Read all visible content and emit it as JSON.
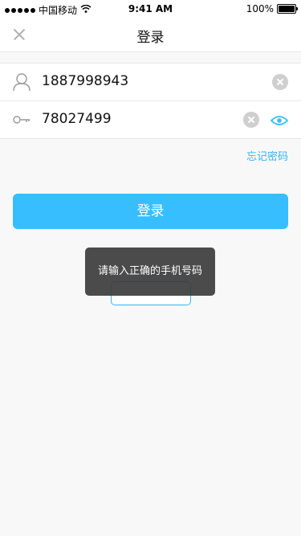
{
  "status_bar": {
    "carrier": "中国移动",
    "time": "9:41 AM",
    "battery": "100%"
  },
  "nav": {
    "title": "登录",
    "close_icon": "close-icon"
  },
  "form": {
    "phone": {
      "icon": "user-icon",
      "value": "1887998943",
      "clear_icon": "clear-icon"
    },
    "password": {
      "icon": "key-icon",
      "value": "78027499",
      "clear_icon": "clear-icon",
      "toggle_icon": "eye-icon"
    }
  },
  "forgot_password": "忘记密码",
  "login_button": "登录",
  "toast": "请输入正确的手机号码",
  "colors": {
    "accent": "#37beff",
    "link": "#37b4f2",
    "toast_bg": "#3c3c3c"
  }
}
